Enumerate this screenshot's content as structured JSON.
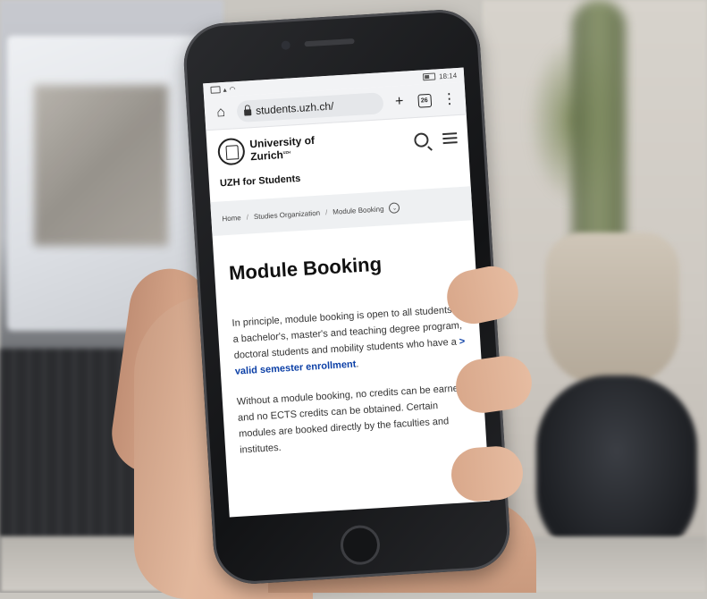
{
  "status_bar": {
    "time": "18:14"
  },
  "browser": {
    "url": "students.uzh.ch/",
    "tabs_count": "26"
  },
  "site": {
    "logo_line1": "University of",
    "logo_line2": "Zurich",
    "logo_superscript": "UZH",
    "section_title": "UZH for Students"
  },
  "breadcrumb": {
    "items": [
      "Home",
      "Studies Organization",
      "Module Booking"
    ],
    "separator": "/"
  },
  "content": {
    "title": "Module Booking",
    "para1_text": "In principle, module booking is open to all students in a bachelor's, master's and teaching degree program, doctoral students and mobility students who have a ",
    "para1_link_prefix": "> ",
    "para1_link": "valid semester enrollment",
    "para1_end": ".",
    "para2": "Without a module booking, no credits can be earned and no ECTS credits can be obtained. Certain modules are booked directly by the faculties and institutes."
  },
  "icons": {
    "home": "home-icon",
    "lock": "lock-icon",
    "new_tab": "plus-icon",
    "tabs": "tabs-icon",
    "overflow": "more-vertical-icon",
    "search": "search-icon",
    "menu": "hamburger-menu-icon",
    "breadcrumb_toggle": "chevron-down-icon"
  }
}
